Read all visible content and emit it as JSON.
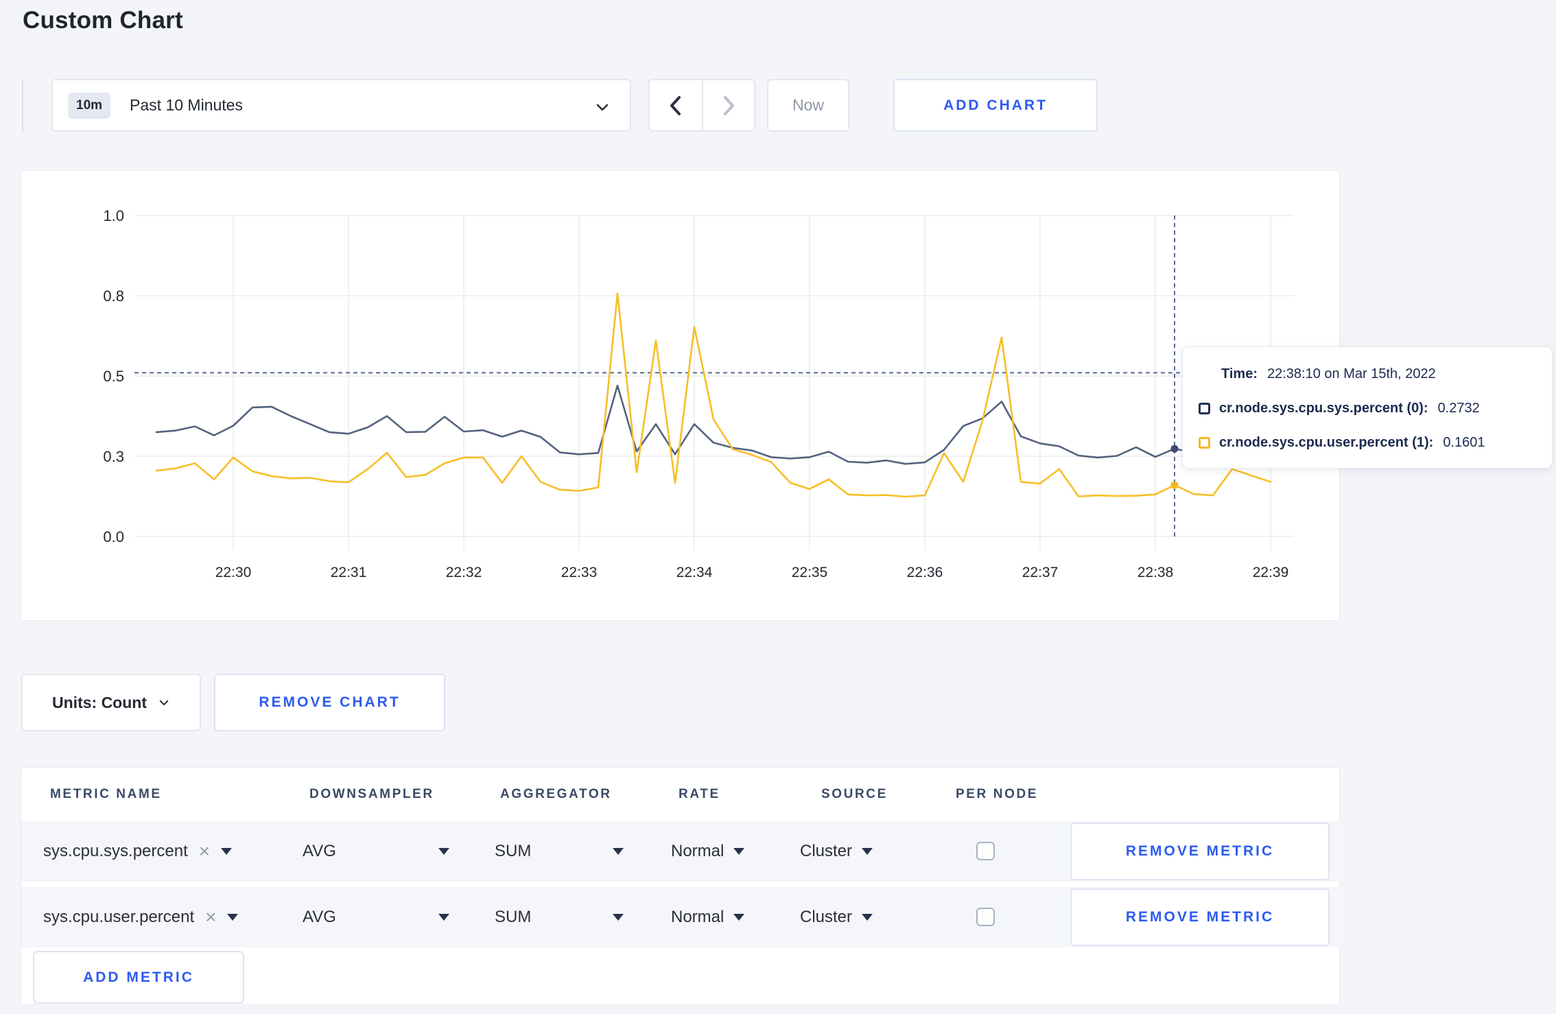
{
  "page": {
    "title": "Custom Chart"
  },
  "toolbar": {
    "range_badge": "10m",
    "range_label": "Past 10 Minutes",
    "now_label": "Now",
    "add_chart_label": "ADD CHART"
  },
  "tooltip": {
    "time_label": "Time:",
    "time_value": "22:38:10 on Mar 15th, 2022",
    "series": [
      {
        "label": "cr.node.sys.cpu.sys.percent (0):",
        "value": "0.2732"
      },
      {
        "label": "cr.node.sys.cpu.user.percent (1):",
        "value": "0.1601"
      }
    ]
  },
  "units_bar": {
    "units_label": "Units: Count",
    "remove_chart_label": "REMOVE CHART"
  },
  "table": {
    "headers": [
      "METRIC NAME",
      "DOWNSAMPLER",
      "AGGREGATOR",
      "RATE",
      "SOURCE",
      "PER NODE"
    ],
    "rows": [
      {
        "metric": "sys.cpu.sys.percent",
        "downsampler": "AVG",
        "aggregator": "SUM",
        "rate": "Normal",
        "source": "Cluster",
        "per_node_checked": false,
        "remove_label": "REMOVE METRIC"
      },
      {
        "metric": "sys.cpu.user.percent",
        "downsampler": "AVG",
        "aggregator": "SUM",
        "rate": "Normal",
        "source": "Cluster",
        "per_node_checked": false,
        "remove_label": "REMOVE METRIC"
      }
    ],
    "add_metric_label": "ADD METRIC"
  },
  "chart_data": {
    "type": "line",
    "x_origin": "22:30:00",
    "x_ticks": [
      {
        "label": "22:30",
        "time": "22:30:00"
      },
      {
        "label": "22:31",
        "time": "22:31:00"
      },
      {
        "label": "22:32",
        "time": "22:32:00"
      },
      {
        "label": "22:33",
        "time": "22:33:00"
      },
      {
        "label": "22:34",
        "time": "22:34:00"
      },
      {
        "label": "22:35",
        "time": "22:35:00"
      },
      {
        "label": "22:36",
        "time": "22:36:00"
      },
      {
        "label": "22:37",
        "time": "22:37:00"
      },
      {
        "label": "22:38",
        "time": "22:38:00"
      },
      {
        "label": "22:39",
        "time": "22:39:00"
      }
    ],
    "y_ticks": [
      {
        "value": 0,
        "label": "0.0"
      },
      {
        "value": 0.25,
        "label": "0.3"
      },
      {
        "value": 0.5,
        "label": "0.5"
      },
      {
        "value": 0.75,
        "label": "0.8"
      },
      {
        "value": 1,
        "label": "1.0"
      }
    ],
    "ylim": [
      0,
      1
    ],
    "grid": true,
    "series": [
      {
        "name": "cr.node.sys.cpu.sys.percent",
        "color": "#54627e",
        "dot_color": "#3c4c6c",
        "points": [
          [
            "22:29:20",
            0.325
          ],
          [
            "22:29:30",
            0.33
          ],
          [
            "22:29:40",
            0.343
          ],
          [
            "22:29:50",
            0.315
          ],
          [
            "22:30:00",
            0.345
          ],
          [
            "22:30:10",
            0.402
          ],
          [
            "22:30:20",
            0.404
          ],
          [
            "22:30:30",
            0.375
          ],
          [
            "22:30:40",
            0.35
          ],
          [
            "22:30:50",
            0.325
          ],
          [
            "22:31:00",
            0.32
          ],
          [
            "22:31:10",
            0.34
          ],
          [
            "22:31:20",
            0.375
          ],
          [
            "22:31:30",
            0.325
          ],
          [
            "22:31:40",
            0.326
          ],
          [
            "22:31:50",
            0.373
          ],
          [
            "22:32:00",
            0.327
          ],
          [
            "22:32:10",
            0.331
          ],
          [
            "22:32:20",
            0.311
          ],
          [
            "22:32:30",
            0.33
          ],
          [
            "22:32:40",
            0.31
          ],
          [
            "22:32:50",
            0.262
          ],
          [
            "22:33:00",
            0.256
          ],
          [
            "22:33:10",
            0.26
          ],
          [
            "22:33:20",
            0.47
          ],
          [
            "22:33:30",
            0.265
          ],
          [
            "22:33:40",
            0.35
          ],
          [
            "22:33:50",
            0.256
          ],
          [
            "22:34:00",
            0.35
          ],
          [
            "22:34:10",
            0.292
          ],
          [
            "22:34:20",
            0.276
          ],
          [
            "22:34:30",
            0.268
          ],
          [
            "22:34:40",
            0.247
          ],
          [
            "22:34:50",
            0.243
          ],
          [
            "22:35:00",
            0.247
          ],
          [
            "22:35:10",
            0.264
          ],
          [
            "22:35:20",
            0.233
          ],
          [
            "22:35:30",
            0.23
          ],
          [
            "22:35:40",
            0.237
          ],
          [
            "22:35:50",
            0.226
          ],
          [
            "22:36:00",
            0.231
          ],
          [
            "22:36:10",
            0.27
          ],
          [
            "22:36:20",
            0.344
          ],
          [
            "22:36:30",
            0.368
          ],
          [
            "22:36:40",
            0.42
          ],
          [
            "22:36:50",
            0.312
          ],
          [
            "22:37:00",
            0.29
          ],
          [
            "22:37:10",
            0.281
          ],
          [
            "22:37:20",
            0.252
          ],
          [
            "22:37:30",
            0.246
          ],
          [
            "22:37:40",
            0.251
          ],
          [
            "22:37:50",
            0.278
          ],
          [
            "22:38:00",
            0.248
          ],
          [
            "22:38:10",
            0.2732
          ],
          [
            "22:38:20",
            0.262
          ],
          [
            "22:38:30",
            0.27
          ],
          [
            "22:38:40",
            0.281
          ],
          [
            "22:38:50",
            0.286
          ],
          [
            "22:39:00",
            0.298
          ]
        ]
      },
      {
        "name": "cr.node.sys.cpu.user.percent",
        "color": "#f6bf26",
        "dot_color": "#f2b824",
        "points": [
          [
            "22:29:20",
            0.205
          ],
          [
            "22:29:30",
            0.212
          ],
          [
            "22:29:40",
            0.228
          ],
          [
            "22:29:50",
            0.178
          ],
          [
            "22:30:00",
            0.246
          ],
          [
            "22:30:10",
            0.203
          ],
          [
            "22:30:20",
            0.188
          ],
          [
            "22:30:30",
            0.181
          ],
          [
            "22:30:40",
            0.183
          ],
          [
            "22:30:50",
            0.172
          ],
          [
            "22:31:00",
            0.169
          ],
          [
            "22:31:10",
            0.21
          ],
          [
            "22:31:20",
            0.261
          ],
          [
            "22:31:30",
            0.185
          ],
          [
            "22:31:40",
            0.192
          ],
          [
            "22:31:50",
            0.228
          ],
          [
            "22:32:00",
            0.246
          ],
          [
            "22:32:10",
            0.246
          ],
          [
            "22:32:20",
            0.167
          ],
          [
            "22:32:30",
            0.25
          ],
          [
            "22:32:40",
            0.17
          ],
          [
            "22:32:50",
            0.146
          ],
          [
            "22:33:00",
            0.142
          ],
          [
            "22:33:10",
            0.153
          ],
          [
            "22:33:20",
            0.757
          ],
          [
            "22:33:30",
            0.2
          ],
          [
            "22:33:40",
            0.61
          ],
          [
            "22:33:50",
            0.167
          ],
          [
            "22:34:00",
            0.653
          ],
          [
            "22:34:10",
            0.365
          ],
          [
            "22:34:20",
            0.272
          ],
          [
            "22:34:30",
            0.254
          ],
          [
            "22:34:40",
            0.232
          ],
          [
            "22:34:50",
            0.167
          ],
          [
            "22:35:00",
            0.148
          ],
          [
            "22:35:10",
            0.178
          ],
          [
            "22:35:20",
            0.131
          ],
          [
            "22:35:30",
            0.128
          ],
          [
            "22:35:40",
            0.129
          ],
          [
            "22:35:50",
            0.124
          ],
          [
            "22:36:00",
            0.128
          ],
          [
            "22:36:10",
            0.26
          ],
          [
            "22:36:20",
            0.17
          ],
          [
            "22:36:30",
            0.36
          ],
          [
            "22:36:40",
            0.62
          ],
          [
            "22:36:50",
            0.17
          ],
          [
            "22:37:00",
            0.165
          ],
          [
            "22:37:10",
            0.21
          ],
          [
            "22:37:20",
            0.125
          ],
          [
            "22:37:30",
            0.128
          ],
          [
            "22:37:40",
            0.126
          ],
          [
            "22:37:50",
            0.127
          ],
          [
            "22:38:00",
            0.131
          ],
          [
            "22:38:10",
            0.1601
          ],
          [
            "22:38:20",
            0.132
          ],
          [
            "22:38:30",
            0.128
          ],
          [
            "22:38:40",
            0.21
          ],
          [
            "22:38:50",
            0.19
          ],
          [
            "22:39:00",
            0.17
          ]
        ]
      }
    ],
    "crosshair": {
      "time": "22:38:10",
      "guide_value": 0.51,
      "dot_values": [
        0.2732,
        0.1601
      ]
    },
    "colors": {
      "gridline": "#ececec",
      "dashed": "#53688a",
      "tick_text": "#24292f"
    }
  }
}
